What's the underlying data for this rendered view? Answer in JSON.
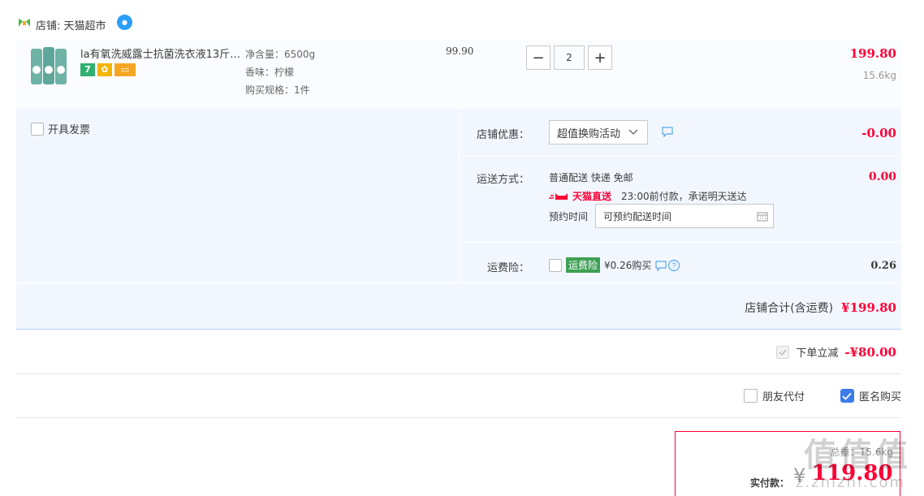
{
  "shop": {
    "label": "店铺: 天猫超市",
    "badge_icon": "level-badge-icon"
  },
  "product": {
    "name": "la有氧洗威露士抗菌洗衣液13斤…",
    "attrs": [
      "净含量：6500g",
      "香味：柠檬",
      "购买规格：1件"
    ],
    "unit_price": "99.90",
    "quantity": "2",
    "minus": "−",
    "plus": "+",
    "line_total": "199.80",
    "weight": "15.6kg",
    "badge_seven": "7"
  },
  "invoice": {
    "label": "开具发票"
  },
  "coupon": {
    "label": "店铺优惠：",
    "selected": "超值换购活动",
    "amount": "-0.00"
  },
  "shipping": {
    "label": "运送方式：",
    "method": "普通配送 快递 免邮",
    "direct_brand": "天猫直送",
    "direct_note": "23:00前付款，承诺明天送达",
    "appt_label": "预约时间",
    "appt_placeholder": "可预约配送时间",
    "amount": "0.00"
  },
  "insurance": {
    "label": "运费险：",
    "tag": "运费险",
    "price": "¥0.26购买",
    "amount": "0.26"
  },
  "shop_total": {
    "label": "店铺合计(含运费)",
    "value": "¥199.80"
  },
  "discount": {
    "label": "下单立减",
    "value": "-¥80.00"
  },
  "pay_options": {
    "friend_pay": "朋友代付",
    "anonymous": "匿名购买"
  },
  "final": {
    "weight": "总重：15.6kg",
    "label": "实付款：",
    "yen": "¥",
    "amount": "119.80"
  },
  "watermark": {
    "main": "值值值",
    "sub": "z.zhizhi.com"
  },
  "colors": {
    "accent_red": "#ff0036",
    "panel_bg": "#f2f7ff",
    "checkbox_blue": "#3a7ce9",
    "insurance_green": "#3ea055"
  }
}
